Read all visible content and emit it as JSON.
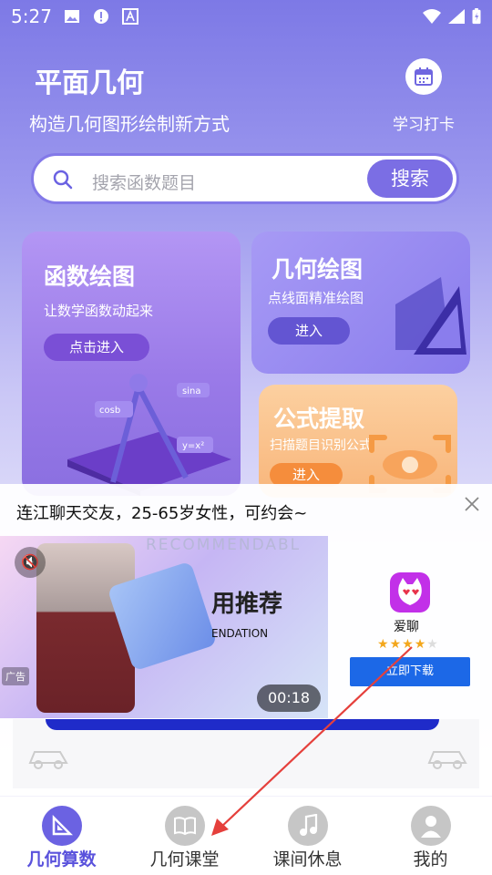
{
  "status_bar": {
    "time": "5:27"
  },
  "header": {
    "title": "平面几何",
    "subtitle": "构造几何图形绘制新方式",
    "checkin_label": "学习打卡"
  },
  "search": {
    "placeholder": "搜索函数题目",
    "button_label": "搜索"
  },
  "cards": [
    {
      "title": "函数绘图",
      "subtitle": "让数学函数动起来",
      "button": "点击进入",
      "decor": [
        "cosb",
        "sina",
        "y=x²"
      ]
    },
    {
      "title": "几何绘图",
      "subtitle": "点线面精准绘图",
      "button": "进入"
    },
    {
      "title": "公式提取",
      "subtitle": "扫描题目识别公式",
      "button": "进入"
    }
  ],
  "ad": {
    "title": "连江聊天交友，25-65岁女性，可约会~",
    "image_text_top": "RECOMMENDABL",
    "image_text_main": "用推荐",
    "image_text_sub": "ENDATION",
    "ad_tag": "广告",
    "duration": "00:18",
    "app_name": "爱聊",
    "rating_stars": 4,
    "download_label": "立即下载"
  },
  "bottom_nav": [
    {
      "label": "几何算数",
      "active": true,
      "icon": "geometry-icon"
    },
    {
      "label": "几何课堂",
      "active": false,
      "icon": "book-icon"
    },
    {
      "label": "课间休息",
      "active": false,
      "icon": "music-icon"
    },
    {
      "label": "我的",
      "active": false,
      "icon": "user-icon"
    }
  ],
  "colors": {
    "accent": "#6b62e2",
    "search_button": "#7b6ee4",
    "download": "#1c68e7",
    "arrow": "#e5403c"
  }
}
